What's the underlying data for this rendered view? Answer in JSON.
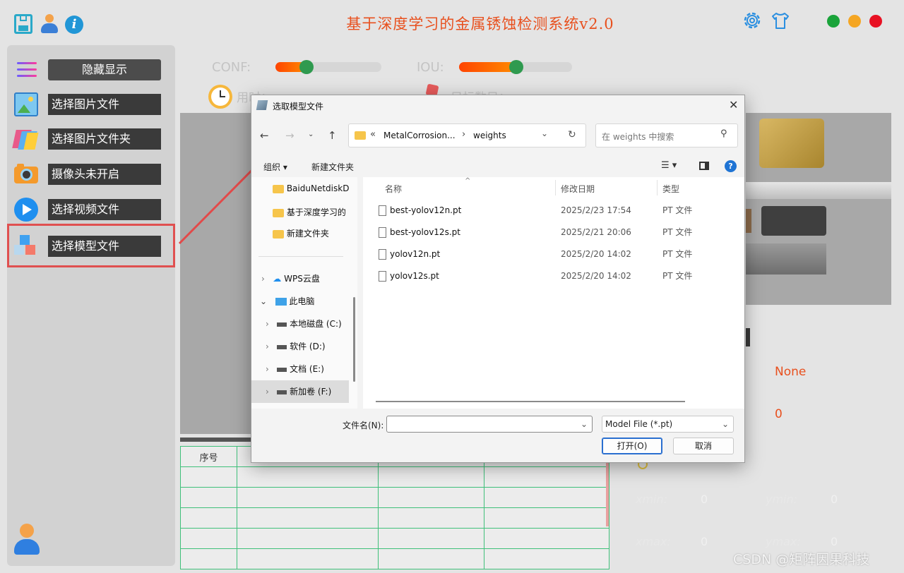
{
  "app": {
    "title": "基于深度学习的金属锈蚀检测系统v2.0",
    "window_colors": {
      "close": "#e81123",
      "minimize": "#f5a623",
      "maximize": "#1aa33a"
    }
  },
  "sidebar": {
    "toggle_label": "隐藏显示",
    "items": [
      {
        "label": "选择图片文件",
        "icon": "image-icon"
      },
      {
        "label": "选择图片文件夹",
        "icon": "folder-stack-icon"
      },
      {
        "label": "摄像头未开启",
        "icon": "camera-icon"
      },
      {
        "label": "选择视频文件",
        "icon": "play-icon"
      },
      {
        "label": "选择模型文件",
        "icon": "cubes-icon"
      }
    ]
  },
  "controls": {
    "conf_label": "CONF:",
    "conf_value": 0.3,
    "iou_label": "IOU:",
    "iou_value": 0.5,
    "time_label": "用时：",
    "count_label": "目标数目："
  },
  "table": {
    "headers": [
      "序号",
      "",
      "",
      ""
    ]
  },
  "result_panel": {
    "class_value": "None",
    "conf_value": "0",
    "xmin_label": "xmin:",
    "xmin_value": "0",
    "ymin_label": "ymin:",
    "ymin_value": "0",
    "xmax_label": "xmax:",
    "xmax_value": "0",
    "ymax_label": "ymax:",
    "ymax_value": "0"
  },
  "dialog": {
    "title": "选取模型文件",
    "path_prefix": "«",
    "path_segment1": "MetalCorrosion...",
    "path_separator": "›",
    "path_segment2": "weights",
    "search_placeholder": "在 weights 中搜索",
    "toolbar_organize": "组织 ▾",
    "toolbar_new_folder": "新建文件夹",
    "nav_items": [
      {
        "label": "BaiduNetdiskD",
        "type": "folder"
      },
      {
        "label": "基于深度学习的",
        "type": "folder"
      },
      {
        "label": "新建文件夹",
        "type": "folder"
      },
      {
        "label": "WPS云盘",
        "type": "cloud"
      },
      {
        "label": "此电脑",
        "type": "pc"
      },
      {
        "label": "本地磁盘 (C:)",
        "type": "drive"
      },
      {
        "label": "软件 (D:)",
        "type": "drive"
      },
      {
        "label": "文档 (E:)",
        "type": "drive"
      },
      {
        "label": "新加卷 (F:)",
        "type": "drive"
      }
    ],
    "columns": {
      "name": "名称",
      "date": "修改日期",
      "type": "类型"
    },
    "files": [
      {
        "name": "best-yolov12n.pt",
        "date": "2025/2/23 17:54",
        "type": "PT 文件"
      },
      {
        "name": "best-yolov12s.pt",
        "date": "2025/2/21 20:06",
        "type": "PT 文件"
      },
      {
        "name": "yolov12n.pt",
        "date": "2025/2/20 14:02",
        "type": "PT 文件"
      },
      {
        "name": "yolov12s.pt",
        "date": "2025/2/20 14:02",
        "type": "PT 文件"
      }
    ],
    "filename_label": "文件名(N):",
    "filename_value": "",
    "filter_value": "Model File (*.pt)",
    "open_label": "打开(O)",
    "cancel_label": "取消"
  },
  "watermark": "CSDN @矩阵因果科技"
}
